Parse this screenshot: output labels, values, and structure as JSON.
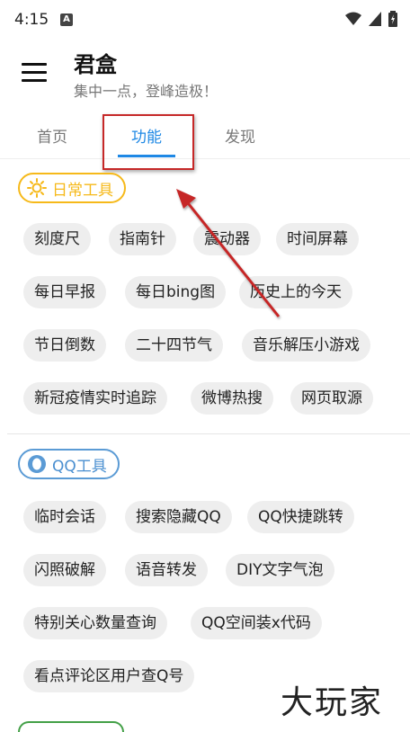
{
  "status": {
    "time": "4:15",
    "notif_letter": "A"
  },
  "app": {
    "title": "君盒",
    "subtitle": "集中一点，登峰造极！"
  },
  "tabs": [
    "首页",
    "功能",
    "发现"
  ],
  "sections": [
    {
      "title": "日常工具",
      "color": "#f6b91a",
      "chips": [
        "刻度尺",
        "指南针",
        "震动器",
        "时间屏幕",
        "每日早报",
        "每日bing图",
        "历史上的今天",
        "节日倒数",
        "二十四节气",
        "音乐解压小游戏",
        "新冠疫情实时追踪",
        "微博热搜",
        "网页取源"
      ]
    },
    {
      "title": "QQ工具",
      "color": "#5b9bd5",
      "chips": [
        "临时会话",
        "搜索隐藏QQ",
        "QQ快捷跳转",
        "闪照破解",
        "语音转发",
        "DIY文字气泡",
        "特别关心数量查询",
        "QQ空间装x代码",
        "看点评论区用户查Q号"
      ]
    }
  ],
  "watermark": "大玩家",
  "colors": {
    "accent": "#1e88e5",
    "annotation": "#c62828"
  }
}
